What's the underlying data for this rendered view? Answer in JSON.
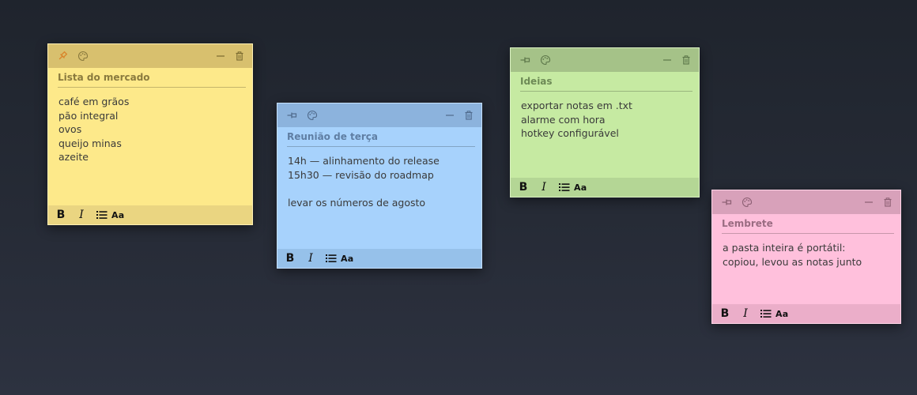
{
  "notes": [
    {
      "title": "Lista do mercado",
      "body": "café em grãos\npão integral\novos\nqueijo minas\nazeite",
      "pinned": true,
      "color": "#fde98a",
      "icons": [
        "pin-icon",
        "palette-icon",
        "minimize-icon",
        "trash-icon"
      ],
      "format": {
        "bold": "B",
        "italic": "I",
        "font": "Aa"
      }
    },
    {
      "title": "Reunião de terça",
      "body": "14h — alinhamento do release\n15h30 — revisão do roadmap\n\nlevar os números de agosto",
      "pinned": false,
      "color": "#a7d2fc",
      "icons": [
        "pin-icon",
        "palette-icon",
        "minimize-icon",
        "trash-icon"
      ],
      "format": {
        "bold": "B",
        "italic": "I",
        "font": "Aa"
      }
    },
    {
      "title": "Ideias",
      "body": "exportar notas em .txt\nalarme com hora\nhotkey configurável",
      "pinned": false,
      "color": "#c6eaa2",
      "icons": [
        "pin-icon",
        "palette-icon",
        "minimize-icon",
        "trash-icon"
      ],
      "format": {
        "bold": "B",
        "italic": "I",
        "font": "Aa"
      }
    },
    {
      "title": "Lembrete",
      "body": "a pasta inteira é portátil:\ncopiou, levou as notas junto",
      "pinned": false,
      "color": "#ffc0dc",
      "icons": [
        "pin-icon",
        "palette-icon",
        "minimize-icon",
        "trash-icon"
      ],
      "format": {
        "bold": "B",
        "italic": "I",
        "font": "Aa"
      }
    }
  ]
}
